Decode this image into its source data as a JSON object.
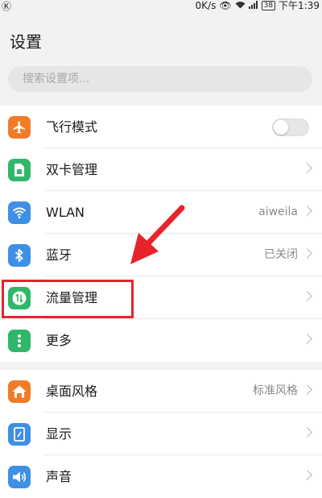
{
  "status_bar": {
    "left_icon": "k-circle-icon",
    "speed": "0K/s",
    "battery": "38",
    "time": "下午1:39"
  },
  "page_title": "设置",
  "search": {
    "placeholder": "搜索设置项..."
  },
  "group1": [
    {
      "label": "飞行模式",
      "icon": "airplane-icon",
      "color": "#f07c2a",
      "control": "toggle",
      "toggle_on": false
    },
    {
      "label": "双卡管理",
      "icon": "sim-card-icon",
      "color": "#2fb86a",
      "control": "chevron"
    },
    {
      "label": "WLAN",
      "icon": "wifi-icon",
      "color": "#3e8fe6",
      "value": "aiweila",
      "control": "chevron"
    },
    {
      "label": "蓝牙",
      "icon": "bluetooth-icon",
      "color": "#3e8fe6",
      "value": "已关闭",
      "control": "chevron"
    },
    {
      "label": "流量管理",
      "icon": "data-usage-icon",
      "color": "#2fb86a",
      "control": "chevron"
    },
    {
      "label": "更多",
      "icon": "more-dots-icon",
      "color": "#2fb86a",
      "control": "chevron"
    }
  ],
  "group2": [
    {
      "label": "桌面风格",
      "icon": "home-icon",
      "color": "#f07c2a",
      "value": "标准风格",
      "control": "chevron"
    },
    {
      "label": "显示",
      "icon": "display-icon",
      "color": "#3e8fe6",
      "control": "chevron"
    },
    {
      "label": "声音",
      "icon": "speaker-icon",
      "color": "#3e8fe6",
      "control": "chevron"
    }
  ],
  "annotation": {
    "highlight_color": "#e8232a"
  }
}
